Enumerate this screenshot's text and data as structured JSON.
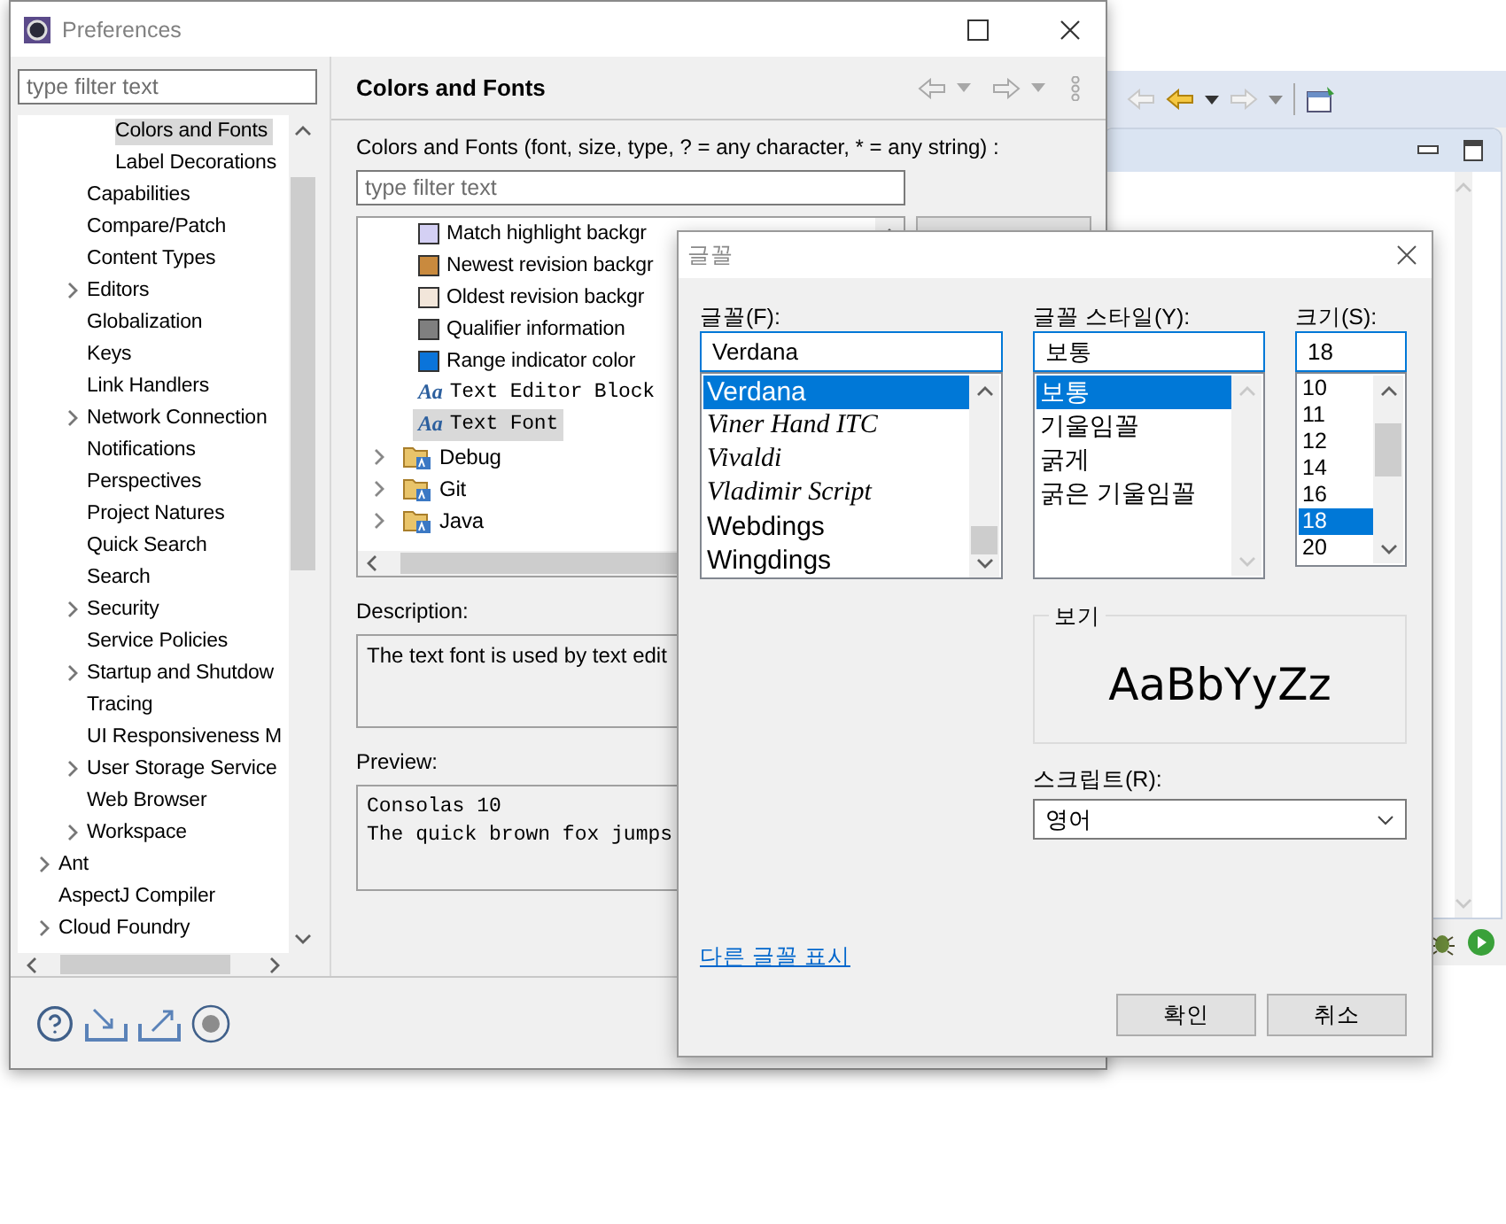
{
  "preferences": {
    "title": "Preferences",
    "filter": {
      "placeholder": "type filter text"
    },
    "tree": [
      {
        "children": [
          {
            "children": [
              {
                "label": "Colors and Fonts",
                "selected": true,
                "expandable": false
              },
              {
                "label": "Label Decorations",
                "selected": false,
                "expandable": false
              }
            ]
          },
          {
            "label": "Capabilities",
            "selected": false,
            "expandable": false
          },
          {
            "label": "Compare/Patch",
            "selected": false,
            "expandable": false
          },
          {
            "label": "Content Types",
            "selected": false,
            "expandable": false
          },
          {
            "label": "Editors",
            "selected": false,
            "expandable": true
          },
          {
            "label": "Globalization",
            "selected": false,
            "expandable": false
          },
          {
            "label": "Keys",
            "selected": false,
            "expandable": false
          },
          {
            "label": "Link Handlers",
            "selected": false,
            "expandable": false
          },
          {
            "label": "Network Connection",
            "selected": false,
            "expandable": true
          },
          {
            "label": "Notifications",
            "selected": false,
            "expandable": false
          },
          {
            "label": "Perspectives",
            "selected": false,
            "expandable": false
          },
          {
            "label": "Project Natures",
            "selected": false,
            "expandable": false
          },
          {
            "label": "Quick Search",
            "selected": false,
            "expandable": false
          },
          {
            "label": "Search",
            "selected": false,
            "expandable": false
          },
          {
            "label": "Security",
            "selected": false,
            "expandable": true
          },
          {
            "label": "Service Policies",
            "selected": false,
            "expandable": false
          },
          {
            "label": "Startup and Shutdow",
            "selected": false,
            "expandable": true
          },
          {
            "label": "Tracing",
            "selected": false,
            "expandable": false
          },
          {
            "label": "UI Responsiveness M",
            "selected": false,
            "expandable": false
          },
          {
            "label": "User Storage Service",
            "selected": false,
            "expandable": true
          },
          {
            "label": "Web Browser",
            "selected": false,
            "expandable": false
          },
          {
            "label": "Workspace",
            "selected": false,
            "expandable": true
          }
        ]
      },
      {
        "label": "Ant",
        "selected": false,
        "expandable": true
      },
      {
        "label": "AspectJ Compiler",
        "selected": false,
        "expandable": false
      },
      {
        "label": "Cloud Foundry",
        "selected": false,
        "expandable": true
      }
    ],
    "page": {
      "title": "Colors and Fonts",
      "hint": "Colors and Fonts (font, size, type, ? = any character, * = any string) :",
      "filter": {
        "placeholder": "type filter text"
      },
      "items": [
        {
          "kind": "color",
          "label": "Match highlight backgr",
          "color": "#d4d0f4",
          "selected": false
        },
        {
          "kind": "color",
          "label": "Newest revision backgr",
          "color": "#c98a3e",
          "selected": false
        },
        {
          "kind": "color",
          "label": "Oldest revision backgr",
          "color": "#f2e6da",
          "selected": false
        },
        {
          "kind": "color",
          "label": "Qualifier information",
          "color": "#7f7f7f",
          "selected": false
        },
        {
          "kind": "color",
          "label": "Range indicator color",
          "color": "#0a74da",
          "selected": false
        },
        {
          "kind": "font",
          "icon": "Aa",
          "label": "Text Editor Block",
          "selected": false
        },
        {
          "kind": "font",
          "icon": "Aa",
          "label": "Text Font",
          "selected": true
        },
        {
          "kind": "category",
          "label": "Debug",
          "selected": false
        },
        {
          "kind": "category",
          "label": "Git",
          "selected": false
        },
        {
          "kind": "category",
          "label": "Java",
          "selected": false
        }
      ],
      "description_label": "Description:",
      "description": "The text font is used by text edit",
      "preview_label": "Preview:",
      "preview_lines": [
        "Consolas 10",
        "The quick brown fox jumps"
      ]
    }
  },
  "font_dialog": {
    "title": "글꼴",
    "font": {
      "label": "글꼴(F):",
      "value": "Verdana",
      "options": [
        {
          "label": "Verdana",
          "kind": "plain",
          "selected": true
        },
        {
          "label": "Viner Hand ITC",
          "kind": "script",
          "selected": false
        },
        {
          "label": "Vivaldi",
          "kind": "script",
          "selected": false
        },
        {
          "label": "Vladimir Script",
          "kind": "script",
          "selected": false
        },
        {
          "label": "Webdings",
          "kind": "plain",
          "selected": false
        },
        {
          "label": "Wingdings",
          "kind": "plain",
          "selected": false
        }
      ]
    },
    "style": {
      "label": "글꼴 스타일(Y):",
      "value": "보통",
      "options": [
        {
          "label": "보통",
          "selected": true
        },
        {
          "label": "기울임꼴",
          "selected": false
        },
        {
          "label": "굵게",
          "selected": false
        },
        {
          "label": "굵은 기울임꼴",
          "selected": false
        }
      ]
    },
    "size": {
      "label": "크기(S):",
      "value": "18",
      "options": [
        {
          "label": "10",
          "selected": false
        },
        {
          "label": "11",
          "selected": false
        },
        {
          "label": "12",
          "selected": false
        },
        {
          "label": "14",
          "selected": false
        },
        {
          "label": "16",
          "selected": false
        },
        {
          "label": "18",
          "selected": true
        },
        {
          "label": "20",
          "selected": false
        }
      ]
    },
    "sample": {
      "label": "보기",
      "text": "AaBbYyZz"
    },
    "script": {
      "label": "스크립트(R):",
      "value": "영어"
    },
    "link": "다른 글꼴 표시",
    "buttons": [
      "확인",
      "취소"
    ]
  }
}
